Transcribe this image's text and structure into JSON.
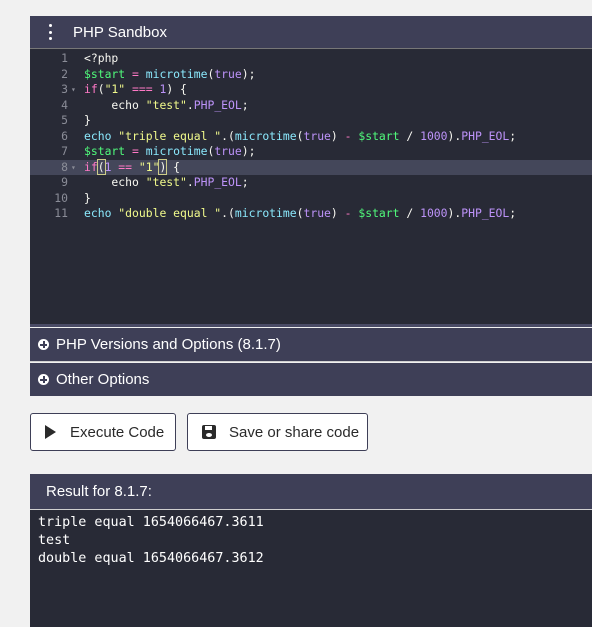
{
  "sandbox": {
    "title": "PHP Sandbox"
  },
  "editor": {
    "line_numbers": [
      "1",
      "2",
      "3",
      "4",
      "5",
      "6",
      "7",
      "8",
      "9",
      "10",
      "11"
    ],
    "lines": [
      [
        {
          "c": "",
          "t": "<?php"
        }
      ],
      [
        {
          "c": "t-var",
          "t": "$start"
        },
        {
          "c": "",
          "t": " "
        },
        {
          "c": "t-op",
          "t": "="
        },
        {
          "c": "",
          "t": " "
        },
        {
          "c": "t-fn",
          "t": "microtime"
        },
        {
          "c": "",
          "t": "("
        },
        {
          "c": "t-const",
          "t": "true"
        },
        {
          "c": "",
          "t": ");"
        }
      ],
      [
        {
          "c": "t-kw",
          "t": "if"
        },
        {
          "c": "",
          "t": "("
        },
        {
          "c": "t-str",
          "t": "\"1\""
        },
        {
          "c": "",
          "t": " "
        },
        {
          "c": "t-op",
          "t": "==="
        },
        {
          "c": "",
          "t": " "
        },
        {
          "c": "t-const",
          "t": "1"
        },
        {
          "c": "",
          "t": ") {"
        }
      ],
      [
        {
          "c": "",
          "t": "    echo "
        },
        {
          "c": "t-str",
          "t": "\"test\""
        },
        {
          "c": "",
          "t": "."
        },
        {
          "c": "t-const",
          "t": "PHP_EOL"
        },
        {
          "c": "",
          "t": ";"
        }
      ],
      [
        {
          "c": "",
          "t": "}"
        }
      ],
      [
        {
          "c": "t-fn",
          "t": "echo"
        },
        {
          "c": "",
          "t": " "
        },
        {
          "c": "t-str",
          "t": "\"triple equal \""
        },
        {
          "c": "",
          "t": ".("
        },
        {
          "c": "t-fn",
          "t": "microtime"
        },
        {
          "c": "",
          "t": "("
        },
        {
          "c": "t-const",
          "t": "true"
        },
        {
          "c": "",
          "t": ") "
        },
        {
          "c": "t-op",
          "t": "-"
        },
        {
          "c": "",
          "t": " "
        },
        {
          "c": "t-var",
          "t": "$start"
        },
        {
          "c": "",
          "t": " / "
        },
        {
          "c": "t-const",
          "t": "1000"
        },
        {
          "c": "",
          "t": ")."
        },
        {
          "c": "t-const",
          "t": "PHP_EOL"
        },
        {
          "c": "",
          "t": ";"
        }
      ],
      [
        {
          "c": "t-var",
          "t": "$start"
        },
        {
          "c": "",
          "t": " "
        },
        {
          "c": "t-op",
          "t": "="
        },
        {
          "c": "",
          "t": " "
        },
        {
          "c": "t-fn",
          "t": "microtime"
        },
        {
          "c": "",
          "t": "("
        },
        {
          "c": "t-const",
          "t": "true"
        },
        {
          "c": "",
          "t": ");"
        }
      ],
      [
        {
          "c": "t-kw",
          "t": "if"
        },
        {
          "c": "t-hl",
          "t": "("
        },
        {
          "c": "t-const",
          "t": "1"
        },
        {
          "c": "",
          "t": " "
        },
        {
          "c": "t-op",
          "t": "=="
        },
        {
          "c": "",
          "t": " "
        },
        {
          "c": "t-str",
          "t": "\"1\""
        },
        {
          "c": "t-hl",
          "t": ")"
        },
        {
          "c": "",
          "t": " {"
        }
      ],
      [
        {
          "c": "",
          "t": "    echo "
        },
        {
          "c": "t-str",
          "t": "\"test\""
        },
        {
          "c": "",
          "t": "."
        },
        {
          "c": "t-const",
          "t": "PHP_EOL"
        },
        {
          "c": "",
          "t": ";"
        }
      ],
      [
        {
          "c": "",
          "t": "}"
        }
      ],
      [
        {
          "c": "t-fn",
          "t": "echo"
        },
        {
          "c": "",
          "t": " "
        },
        {
          "c": "t-str",
          "t": "\"double equal \""
        },
        {
          "c": "",
          "t": ".("
        },
        {
          "c": "t-fn",
          "t": "microtime"
        },
        {
          "c": "",
          "t": "("
        },
        {
          "c": "t-const",
          "t": "true"
        },
        {
          "c": "",
          "t": ") "
        },
        {
          "c": "t-op",
          "t": "-"
        },
        {
          "c": "",
          "t": " "
        },
        {
          "c": "t-var",
          "t": "$start"
        },
        {
          "c": "",
          "t": " / "
        },
        {
          "c": "t-const",
          "t": "1000"
        },
        {
          "c": "",
          "t": ")."
        },
        {
          "c": "t-const",
          "t": "PHP_EOL"
        },
        {
          "c": "",
          "t": ";"
        }
      ]
    ],
    "fold_lines": [
      "3",
      "8"
    ],
    "active_line": "8",
    "fold_glyph": "▾"
  },
  "accordions": {
    "versions": "PHP Versions and Options (8.1.7)",
    "other": "Other Options"
  },
  "buttons": {
    "execute": "Execute Code",
    "save": "Save or share code"
  },
  "result": {
    "title": "Result for 8.1.7:",
    "output": [
      "triple equal 1654066467.3611",
      "test",
      "double equal 1654066467.3612"
    ]
  },
  "colors": {
    "header_bg": "#3e3f57",
    "editor_bg": "#282a36"
  }
}
